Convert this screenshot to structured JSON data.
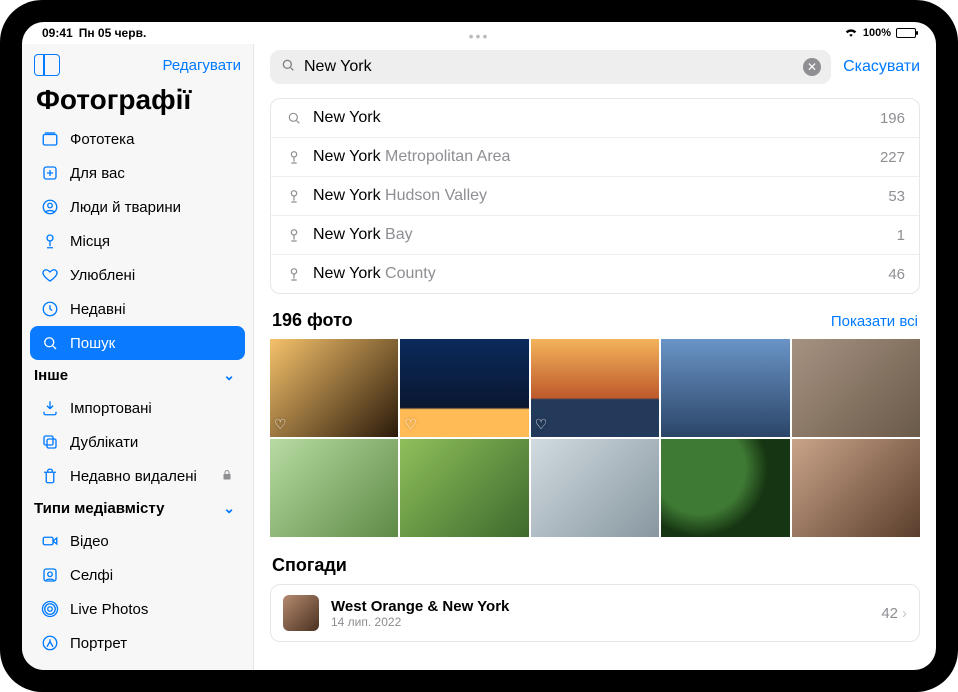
{
  "status": {
    "time": "09:41",
    "date": "Пн 05 черв.",
    "battery": "100%"
  },
  "sidebar": {
    "edit": "Редагувати",
    "title": "Фотографії",
    "items": [
      {
        "label": "Фототека",
        "icon": "library"
      },
      {
        "label": "Для вас",
        "icon": "foryou"
      },
      {
        "label": "Люди й тварини",
        "icon": "people"
      },
      {
        "label": "Місця",
        "icon": "pin"
      },
      {
        "label": "Улюблені",
        "icon": "heart"
      },
      {
        "label": "Недавні",
        "icon": "clock"
      },
      {
        "label": "Пошук",
        "icon": "search",
        "selected": true
      }
    ],
    "section_other": "Інше",
    "other": [
      {
        "label": "Імпортовані",
        "icon": "import"
      },
      {
        "label": "Дублікати",
        "icon": "duplicates"
      },
      {
        "label": "Недавно видалені",
        "icon": "trash",
        "locked": true
      }
    ],
    "section_media": "Типи медіавмісту",
    "media": [
      {
        "label": "Відео",
        "icon": "video"
      },
      {
        "label": "Селфі",
        "icon": "selfie"
      },
      {
        "label": "Live Photos",
        "icon": "live"
      },
      {
        "label": "Портрет",
        "icon": "portrait"
      }
    ]
  },
  "search": {
    "query": "New York",
    "cancel": "Скасувати",
    "suggestions": [
      {
        "type": "search",
        "primary": "New York",
        "secondary": "",
        "count": 196
      },
      {
        "type": "place",
        "primary": "New York",
        "secondary": " Metropolitan Area",
        "count": 227
      },
      {
        "type": "place",
        "primary": "New York",
        "secondary": " Hudson Valley",
        "count": 53
      },
      {
        "type": "place",
        "primary": "New York",
        "secondary": " Bay",
        "count": 1
      },
      {
        "type": "place",
        "primary": "New York",
        "secondary": " County",
        "count": 46
      }
    ]
  },
  "results": {
    "count_title": "196 фото",
    "show_all": "Показати всі",
    "photos": [
      {
        "fav": true
      },
      {
        "fav": true
      },
      {
        "fav": true
      },
      {
        "fav": false
      },
      {
        "fav": false
      },
      {
        "fav": false
      },
      {
        "fav": false
      },
      {
        "fav": false
      },
      {
        "fav": false
      },
      {
        "fav": false
      }
    ]
  },
  "memories": {
    "title": "Спогади",
    "items": [
      {
        "title": "West Orange & New York",
        "date": "14 лип. 2022",
        "count": 42
      }
    ]
  }
}
